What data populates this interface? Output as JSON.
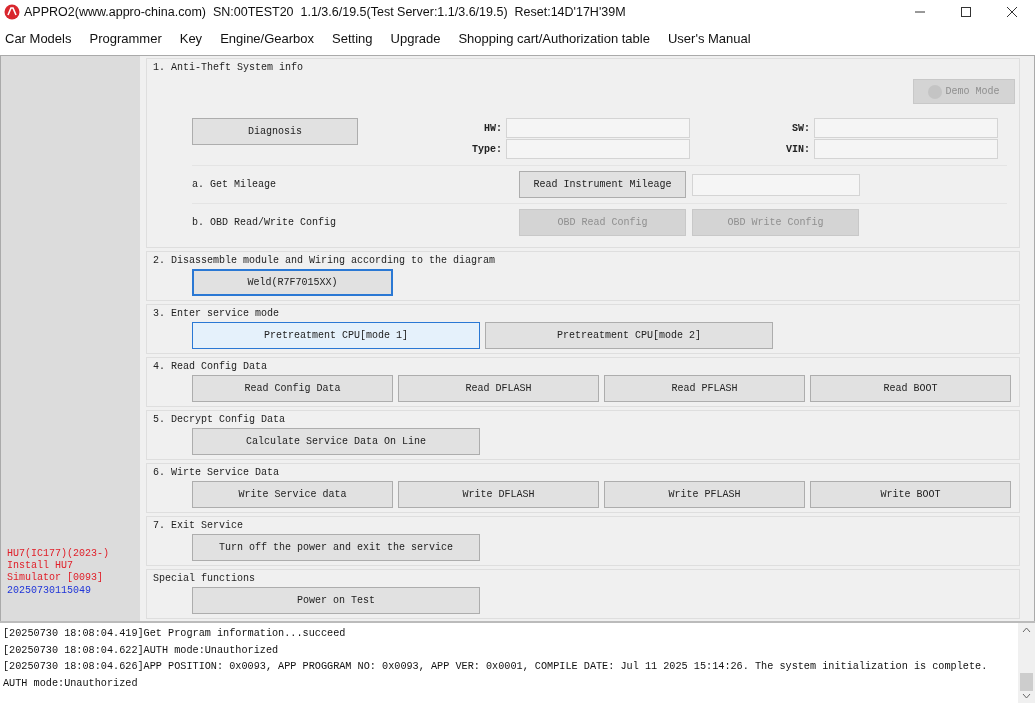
{
  "window": {
    "title": "APPRO2(www.appro-china.com)  SN:00TEST20  1.1/3.6/19.5(Test Server:1.1/3.6/19.5)  Reset:14D'17H'39M"
  },
  "menu": [
    "Car Models",
    "Programmer",
    "Key",
    "Engine/Gearbox",
    "Setting",
    "Upgrade",
    "Shopping cart/Authorization table",
    "User's Manual"
  ],
  "sidebar": {
    "model_lines": [
      "HU7(IC177)(2023-)",
      "Install HU7",
      "Simulator [0093]"
    ],
    "timestamp": "20250730115049"
  },
  "info": {
    "title": "1. Anti-Theft System info",
    "demo_button": {
      "label": "Demo Mode",
      "disabled": true
    },
    "diagnosis_button": {
      "label": "Diagnosis",
      "disabled": false
    },
    "fields": [
      {
        "label": "HW:"
      },
      {
        "label": "SW:"
      },
      {
        "label": "Type:"
      },
      {
        "label": "VIN:"
      }
    ],
    "rows": [
      {
        "label": "a. Get Mileage",
        "buttons": [
          {
            "label": "Read Instrument Mileage",
            "disabled": false
          }
        ],
        "has_field": true
      },
      {
        "label": "b. OBD Read/Write Config",
        "buttons": [
          {
            "label": "OBD Read Config",
            "disabled": true
          },
          {
            "label": "OBD Write Config",
            "disabled": true
          }
        ],
        "has_field": false
      }
    ]
  },
  "sections": [
    {
      "title": "2. Disassemble module and Wiring according to the diagram",
      "buttons": [
        {
          "label": "Weld(R7F7015XX)",
          "focused": true,
          "hovered": false
        }
      ]
    },
    {
      "title": "3. Enter service mode",
      "buttons": [
        {
          "label": "Pretreatment CPU[mode 1]",
          "focused": false,
          "hovered": true
        },
        {
          "label": "Pretreatment CPU[mode 2]",
          "focused": false,
          "hovered": false
        }
      ]
    },
    {
      "title": "4. Read Config Data",
      "buttons": [
        {
          "label": "Read Config Data",
          "focused": false,
          "hovered": false
        },
        {
          "label": "Read DFLASH",
          "focused": false,
          "hovered": false
        },
        {
          "label": "Read PFLASH",
          "focused": false,
          "hovered": false
        },
        {
          "label": "Read BOOT",
          "focused": false,
          "hovered": false
        }
      ]
    },
    {
      "title": "5. Decrypt Config Data",
      "buttons": [
        {
          "label": "Calculate Service Data On Line",
          "focused": false,
          "hovered": false
        }
      ]
    },
    {
      "title": "6. Wirte Service Data",
      "buttons": [
        {
          "label": "Write Service data",
          "focused": false,
          "hovered": false
        },
        {
          "label": "Write DFLASH",
          "focused": false,
          "hovered": false
        },
        {
          "label": "Write PFLASH",
          "focused": false,
          "hovered": false
        },
        {
          "label": "Write BOOT",
          "focused": false,
          "hovered": false
        }
      ]
    },
    {
      "title": "7. Exit Service",
      "buttons": [
        {
          "label": "Turn off the power and exit the service",
          "focused": false,
          "hovered": false
        }
      ]
    },
    {
      "title": "Special functions",
      "buttons": [
        {
          "label": "Power on Test",
          "focused": false,
          "hovered": false
        }
      ]
    }
  ],
  "log": [
    "[20250730 18:08:04.419]Get Program information...succeed",
    "[20250730 18:08:04.622]AUTH mode:Unauthorized",
    "[20250730 18:08:04.626]APP POSITION: 0x0093, APP PROGGRAM NO: 0x0093, APP VER: 0x0001, COMPILE DATE: Jul 11 2025 15:14:26. The system initialization is complete.",
    "AUTH mode:Unauthorized"
  ]
}
